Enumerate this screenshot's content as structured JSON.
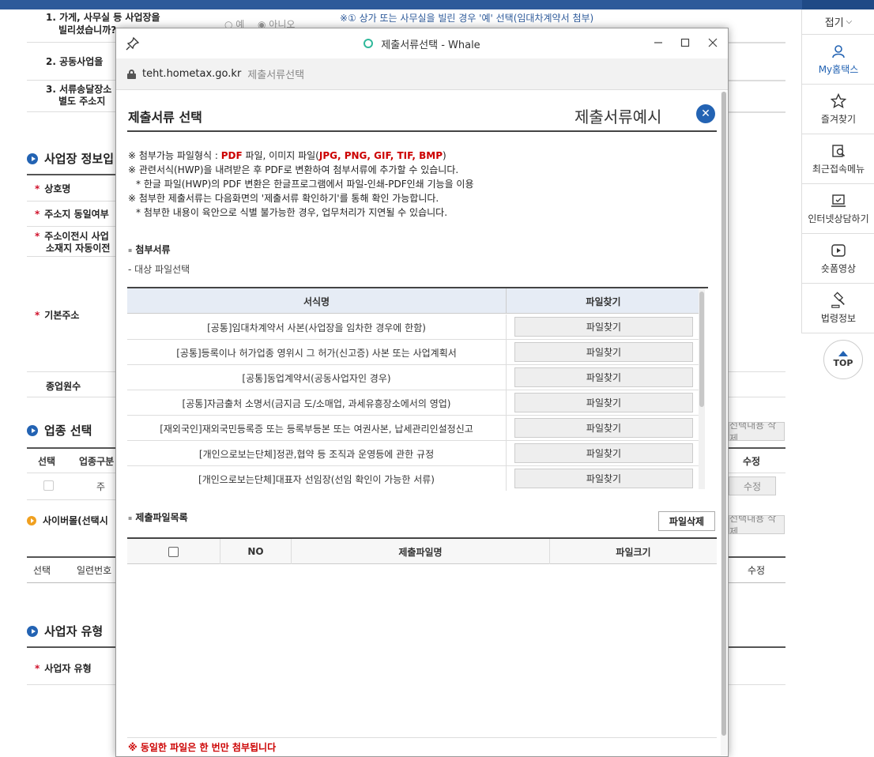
{
  "background": {
    "questions": [
      {
        "line1": "1. 가게, 사무실 등 사업장을",
        "line2": "빌리셨습니까?",
        "radio_yes": "예",
        "radio_no": "아니오",
        "note": "※① 상가 또는 사무실을 빌린 경우 '예' 선택(임대차계약서 첨부)"
      },
      {
        "line1": "2. 공동사업을"
      },
      {
        "line1": "3. 서류송달장소",
        "line2": "별도 주소지"
      }
    ],
    "section_business": "사업장 정보입",
    "labels": {
      "company_name": "상호명",
      "address_same": "주소지 동일여부",
      "address_move_1": "주소이전시 사업",
      "address_move_2": "소재지 자동이전",
      "base_address": "기본주소",
      "employees": "종업원수",
      "business_type": "사업자 유형"
    },
    "section_industry": "업종 선택",
    "industry_delete_btn": "선택내용 삭제",
    "industry_cols": {
      "select": "선택",
      "type": "업종구분",
      "edit": "수정"
    },
    "industry_row": {
      "type": "주",
      "edit_btn": "수정"
    },
    "section_cyber": "사이버몰(선택시",
    "cyber_delete_btn": "선택내용 삭제",
    "cyber_cols": {
      "select": "선택",
      "serial": "일련번호",
      "edit": "수정"
    },
    "section_biztype": "사업자 유형"
  },
  "sidebar": {
    "fold_label": "접기",
    "items": [
      {
        "label": "My홈택스",
        "icon": "user-icon",
        "active": true
      },
      {
        "label": "즐겨찾기",
        "icon": "star-icon",
        "active": false
      },
      {
        "label": "최근접속메뉴",
        "icon": "recent-icon",
        "active": false
      },
      {
        "label": "인터넷상담하기",
        "icon": "consult-icon",
        "active": false
      },
      {
        "label": "숏폼영상",
        "icon": "play-icon",
        "active": false
      },
      {
        "label": "법령정보",
        "icon": "gavel-icon",
        "active": false
      }
    ],
    "top_label": "TOP"
  },
  "popup": {
    "window_title": "제출서류선택 - Whale",
    "address_host": "teht.hometax.go.kr",
    "address_title": "제출서류선택",
    "title": "제출서류 선택",
    "example_label": "제출서류예시",
    "notes": {
      "line1_prefix": "※ 첨부가능 파일형식 : ",
      "line1_pdf": "PDF",
      "line1_mid": " 파일, 이미지 파일(",
      "line1_types": "JPG, PNG, GIF, TIF, BMP",
      "line1_suffix": ")",
      "line2": "※ 관련서식(HWP)을 내려받은 후 PDF로 변환하여 첨부서류에 추가할 수 있습니다.",
      "line3": "* 한글 파일(HWP)의 PDF 변환은 한글프로그램에서 파일-인쇄-PDF인쇄 기능을 이용",
      "line4": "※ 첨부한 제출서류는 다음화면의 '제출서류 확인하기'를 통해 확인 가능합니다.",
      "line5": "* 첨부한 내용이 육안으로 식별 불가능한 경우, 업무처리가 지연될 수 있습니다."
    },
    "attach_section_title": "첨부서류",
    "attach_desc": "- 대상 파일선택",
    "attach_table": {
      "col_name": "서식명",
      "col_find": "파일찾기",
      "rows": [
        {
          "name": "[공통]임대차계약서 사본(사업장을 임차한 경우에 한함)",
          "button": "파일찾기"
        },
        {
          "name": "[공통]등록이나 허가업종 영위시 그 허가(신고증) 사본 또는 사업계획서",
          "button": "파일찾기"
        },
        {
          "name": "[공통]동업계약서(공동사업자인 경우)",
          "button": "파일찾기"
        },
        {
          "name": "[공통]자금출처 소명서(금지금 도/소매업, 과세유흥장소에서의 영업)",
          "button": "파일찾기"
        },
        {
          "name": "[재외국인]재외국민등록증 또는 등록부등본 또는 여권사본, 납세관리인설정신고",
          "button": "파일찾기"
        },
        {
          "name": "[개인으로보는단체]정관,협약 등 조직과 운영등에 관한 규정",
          "button": "파일찾기"
        },
        {
          "name": "[개인으로보는단체]대표자 선임장(선임 확인이 가능한 서류)",
          "button": "파일찾기"
        }
      ]
    },
    "files_section_title": "제출파일목록",
    "delete_button": "파일삭제",
    "files_table": {
      "col_no": "NO",
      "col_name": "제출파일명",
      "col_size": "파일크기"
    },
    "bottom_note": "※ 동일한 파일은 한 번만 첨부됩니다"
  },
  "colors": {
    "accent_blue": "#2363b3",
    "warning_red": "#cc0000",
    "whale_green": "#31b99b"
  }
}
